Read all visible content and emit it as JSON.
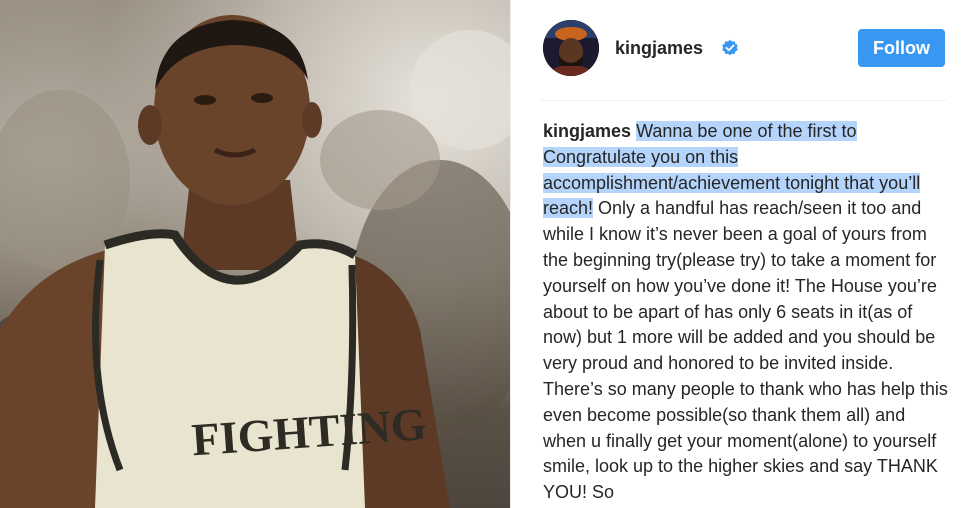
{
  "post": {
    "username": "kingjames",
    "follow_label": "Follow",
    "caption_user": "kingjames",
    "caption_highlighted": "Wanna be one of the first to Congratulate you on this accomplishment/achievement tonight that you’ll reach!",
    "caption_rest": " Only a handful has reach/seen it too and while I know it’s never been a goal of yours from the beginning try(please try) to take a moment for yourself on how you’ve done it! The House you’re about to be apart of has only 6 seats in it(as of now) but 1 more will be added and you should be very proud and honored to be invited inside. There’s so many people to thank who has help this even become possible(so thank them all) and when u finally get your moment(alone) to yourself smile, look up to the higher skies and say THANK YOU! So",
    "jersey_text": "FIGHTING"
  },
  "icons": {
    "verified": "verified-badge-icon",
    "avatar": "profile-avatar"
  },
  "colors": {
    "follow_button": "#3897f0",
    "verified_badge": "#3897f0",
    "text_highlight": "#b4d4fb",
    "text": "#262626"
  }
}
